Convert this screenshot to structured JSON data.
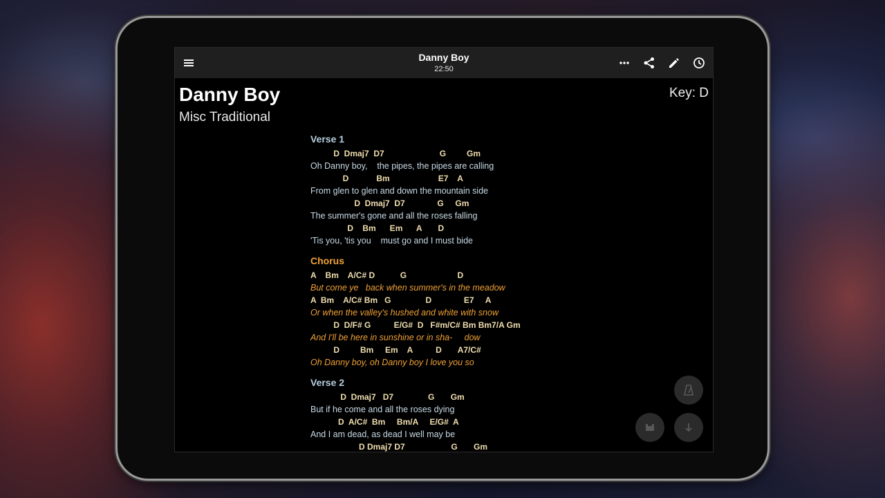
{
  "appbar": {
    "title": "Danny Boy",
    "time": "22:50",
    "menu_icon": "menu-icon",
    "actions": [
      "more-icon",
      "share-icon",
      "edit-icon",
      "clock-icon"
    ]
  },
  "song": {
    "title": "Danny Boy",
    "artist": "Misc Traditional",
    "key": "Key: D"
  },
  "sections": {
    "verse1": {
      "label": "Verse 1",
      "lines": [
        {
          "chords": "          D  Dmaj7  D7                        G         Gm",
          "lyric": "Oh Danny boy,    the pipes, the pipes are calling"
        },
        {
          "chords": "              D            Bm                     E7    A",
          "lyric": "From glen to glen and down the mountain side"
        },
        {
          "chords": "                   D  Dmaj7  D7              G     Gm",
          "lyric": "The summer's gone and all the roses falling"
        },
        {
          "chords": "                D    Bm      Em      A       D",
          "lyric": "'Tis you, 'tis you    must go and I must bide"
        }
      ]
    },
    "chorus": {
      "label": "Chorus",
      "lines": [
        {
          "chords": "A    Bm    A/C# D           G                      D",
          "lyric": "But come ye   back when summer's in the meadow"
        },
        {
          "chords": "A  Bm    A/C# Bm   G               D              E7     A",
          "lyric": "Or when the valley's hushed and white with snow"
        },
        {
          "chords": "          D  D/F# G          E/G#  D   F#m/C# Bm Bm7/A Gm",
          "lyric": "And I'll be here in sunshine or in sha-     dow"
        },
        {
          "chords": "          D         Bm     Em    A          D       A7/C#",
          "lyric": "Oh Danny boy, oh Danny boy I love you so"
        }
      ]
    },
    "verse2": {
      "label": "Verse 2",
      "lines": [
        {
          "chords": "             D  Dmaj7   D7               G       Gm",
          "lyric": "But if he come and all the roses dying"
        },
        {
          "chords": "            D  A/C#  Bm     Bm/A     E/G#  A",
          "lyric": "And I am dead, as dead I well may be"
        },
        {
          "chords": "                     D Dmaj7 D7                    G       Gm",
          "lyric": ""
        }
      ]
    }
  },
  "fabs": {
    "metronome": "metronome-icon",
    "save": "save-icon",
    "scroll": "arrow-down-icon"
  },
  "colors": {
    "verse_label": "#b7cfe0",
    "chorus": "#f0a136",
    "chord": "#f1dfb0",
    "appbar": "#1f1f1f"
  }
}
